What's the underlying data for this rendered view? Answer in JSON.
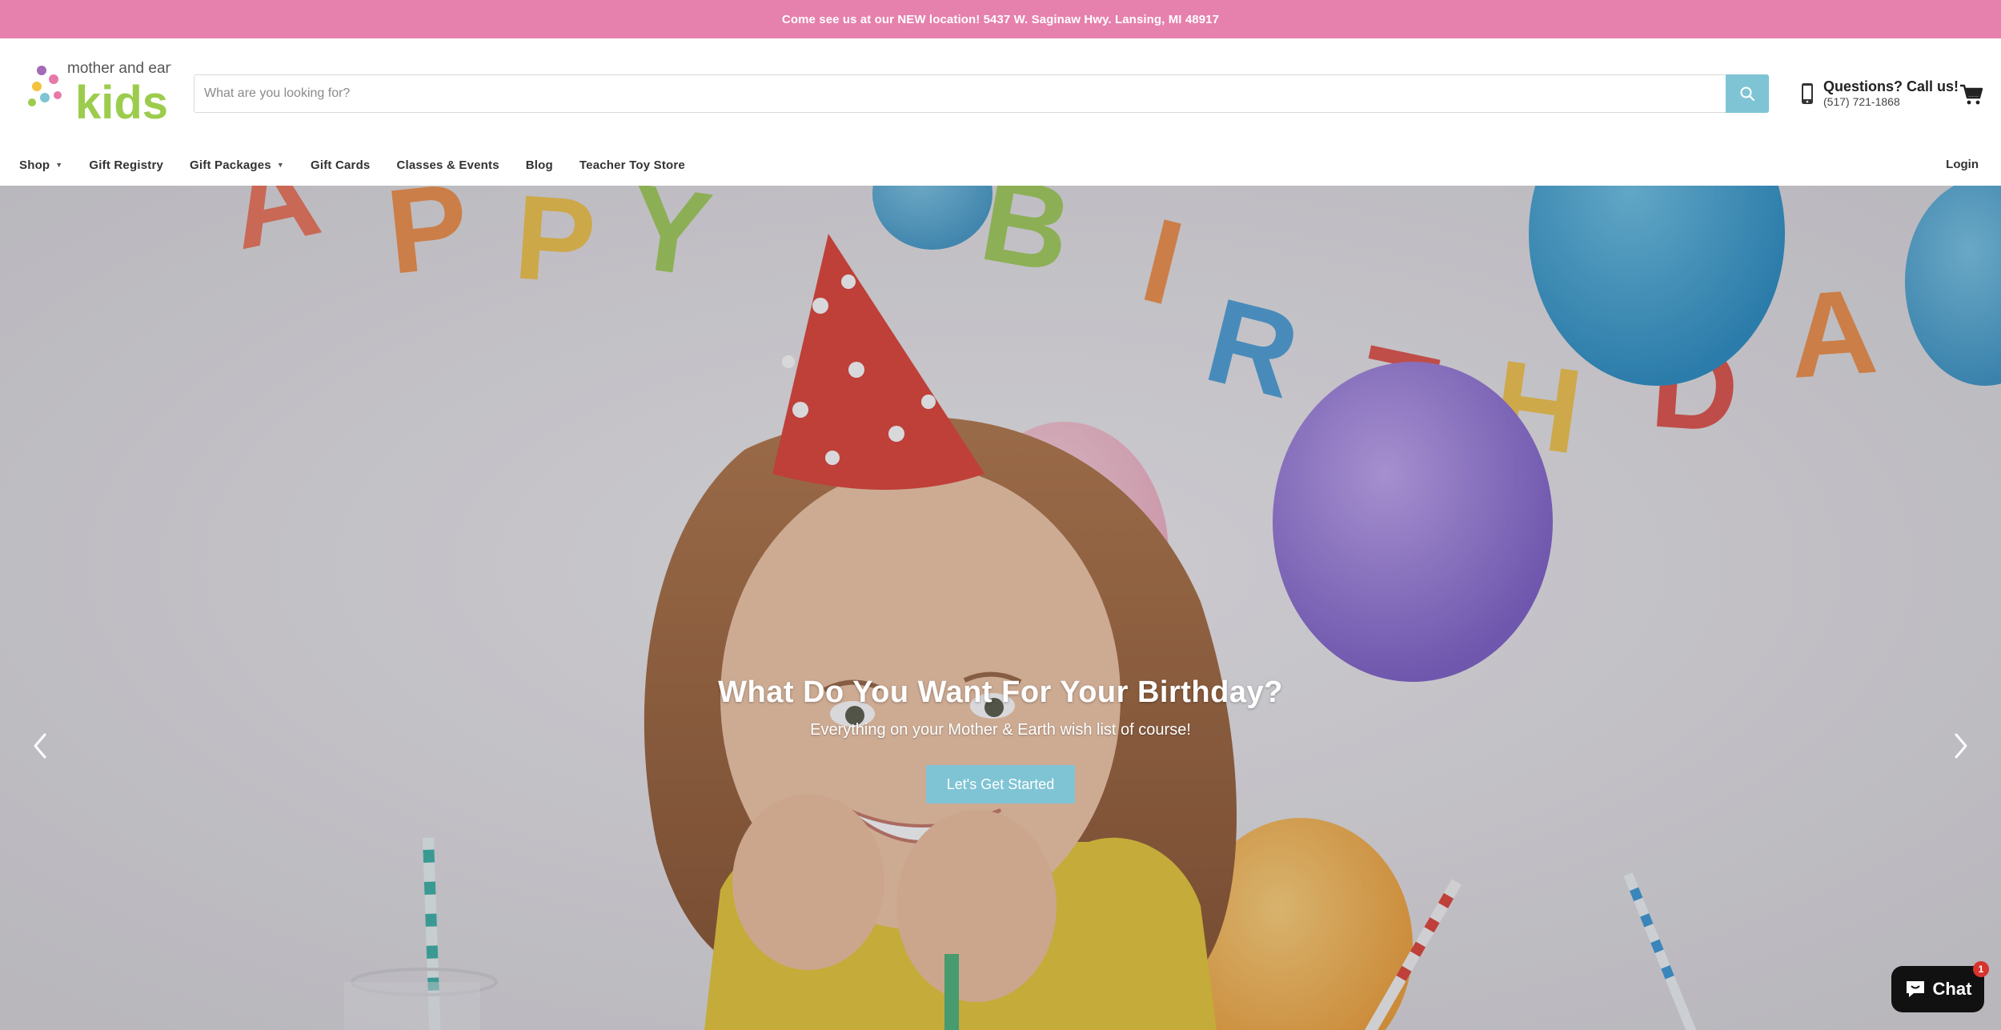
{
  "announcement": {
    "text": "Come see us at our NEW location! 5437 W. Saginaw Hwy. Lansing, MI 48917"
  },
  "logo": {
    "top_text": "mother and earth",
    "main_text": "kids"
  },
  "search": {
    "placeholder": "What are you looking for?",
    "icon": "search-icon"
  },
  "contact": {
    "title": "Questions? Call us!",
    "phone": "(517) 721-1868",
    "icon": "phone-icon"
  },
  "cart": {
    "icon": "cart-icon"
  },
  "nav": {
    "items": [
      {
        "label": "Shop",
        "dropdown": true
      },
      {
        "label": "Gift Registry",
        "dropdown": false
      },
      {
        "label": "Gift Packages",
        "dropdown": true
      },
      {
        "label": "Gift Cards",
        "dropdown": false
      },
      {
        "label": "Classes & Events",
        "dropdown": false
      },
      {
        "label": "Blog",
        "dropdown": false
      },
      {
        "label": "Teacher Toy Store",
        "dropdown": false
      }
    ],
    "login": "Login"
  },
  "hero": {
    "title": "What Do You Want For Your Birthday?",
    "subtitle": "Everything on your Mother & Earth wish list of course!",
    "button": "Let's Get Started",
    "banner_letters": [
      "A",
      "P",
      "P",
      "Y",
      "B",
      "I",
      "R",
      "T",
      "H",
      "D",
      "A"
    ]
  },
  "chat": {
    "label": "Chat",
    "badge": "1",
    "icon": "chat-bubble-icon"
  },
  "colors": {
    "announcement_bg": "#e680ad",
    "accent": "#7fc4d4",
    "chat_bg": "#111111",
    "badge": "#d6342c"
  }
}
